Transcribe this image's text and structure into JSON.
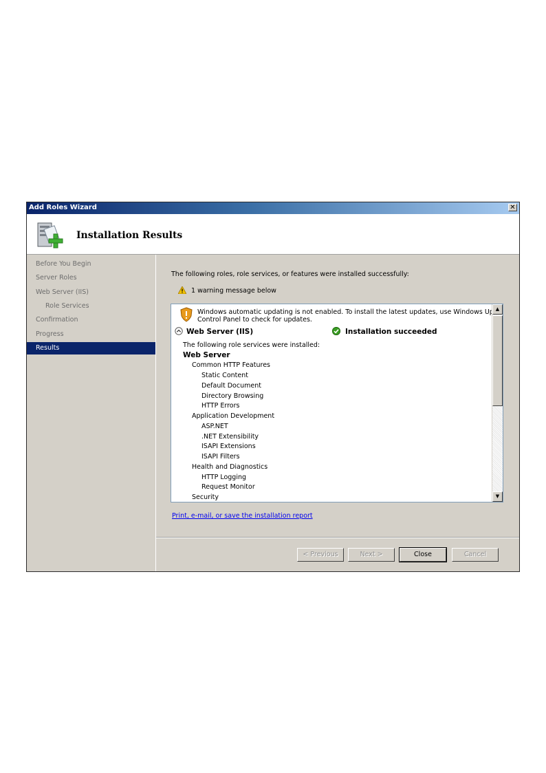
{
  "window": {
    "title": "Add Roles Wizard",
    "close_glyph": "✕"
  },
  "header": {
    "title": "Installation Results",
    "icon": "server-add-icon"
  },
  "sidebar": {
    "items": [
      {
        "label": "Before You Begin"
      },
      {
        "label": "Server Roles"
      },
      {
        "label": "Web Server (IIS)"
      },
      {
        "label": "Role Services"
      },
      {
        "label": "Confirmation"
      },
      {
        "label": "Progress"
      },
      {
        "label": "Results"
      }
    ],
    "active": "Results"
  },
  "main": {
    "intro": "The following roles, role services, or features were installed successfully:",
    "warning_count": "1 warning message below",
    "update_warning_line1": "Windows automatic updating is not enabled. To install the latest updates, use Windows Update in",
    "update_warning_line2": "Control Panel to check for updates.",
    "role_name": "Web Server (IIS)",
    "role_status": "Installation succeeded",
    "installed_heading": "The following role services were installed:",
    "services": [
      {
        "text": "Web Server"
      },
      {
        "text": "Common HTTP Features"
      },
      {
        "text": "Static Content"
      },
      {
        "text": "Default Document"
      },
      {
        "text": "Directory Browsing"
      },
      {
        "text": "HTTP Errors"
      },
      {
        "text": "Application Development"
      },
      {
        "text": "ASP.NET"
      },
      {
        "text": ".NET Extensibility"
      },
      {
        "text": "ISAPI Extensions"
      },
      {
        "text": "ISAPI Filters"
      },
      {
        "text": "Health and Diagnostics"
      },
      {
        "text": "HTTP Logging"
      },
      {
        "text": "Request Monitor"
      },
      {
        "text": "Security"
      }
    ],
    "report_link": "Print, e-mail, or save the installation report"
  },
  "buttons": {
    "previous": "< Previous",
    "next": "Next >",
    "close": "Close",
    "cancel": "Cancel"
  },
  "colors": {
    "active_nav": "#0a246a",
    "success": "#3a9d23",
    "warning": "#f2c200",
    "link": "#0000ee"
  }
}
